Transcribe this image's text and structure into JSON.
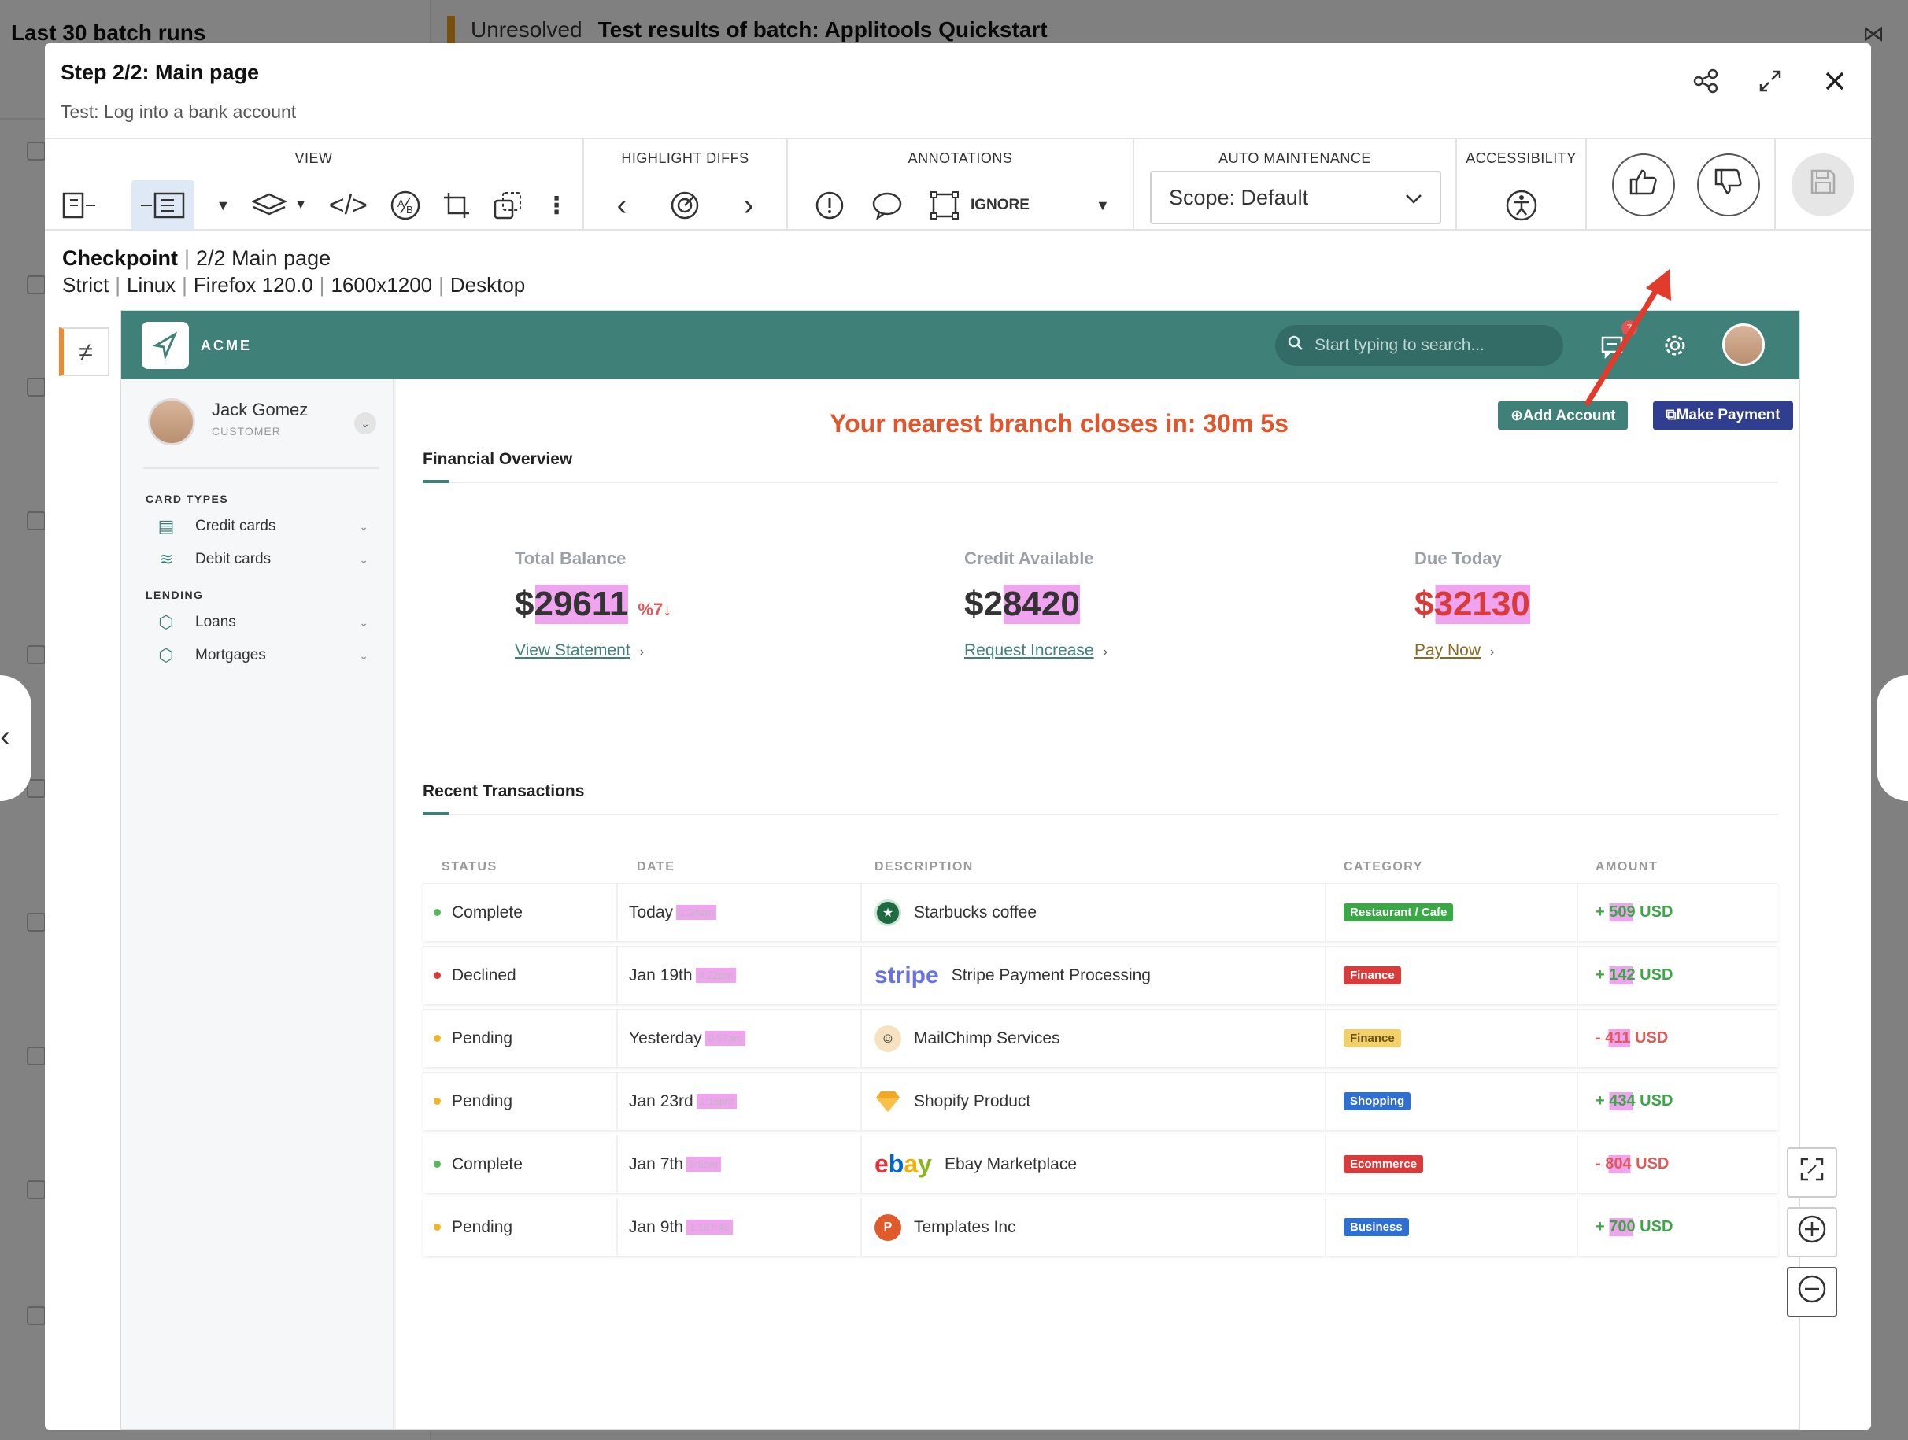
{
  "background": {
    "left_title": "Last 30 batch runs",
    "status": "Unresolved",
    "batch_title": "Test results of batch:  Applitools Quickstart"
  },
  "modal": {
    "step_title": "Step 2/2:  Main page",
    "test_name": "Test: Log into a bank account"
  },
  "toolbar": {
    "view_label": "VIEW",
    "highlight_label": "HIGHLIGHT DIFFS",
    "annotations_label": "ANNOTATIONS",
    "ignore_label": "IGNORE",
    "auto_label": "AUTO MAINTENANCE",
    "scope_value": "Scope: Default",
    "accessibility_label": "ACCESSIBILITY"
  },
  "checkpoint": {
    "label": "Checkpoint",
    "name": "2/2 Main page",
    "details": [
      "Strict",
      "Linux",
      "Firefox 120.0",
      "1600x1200",
      "Desktop"
    ]
  },
  "app": {
    "logo_text": "ACME",
    "search_placeholder": "Start typing to search...",
    "notification_count": "7",
    "user_name": "Jack Gomez",
    "user_role": "CUSTOMER",
    "sections": [
      {
        "title": "CARD TYPES",
        "items": [
          {
            "label": "Credit cards"
          },
          {
            "label": "Debit cards"
          }
        ]
      },
      {
        "title": "LENDING",
        "items": [
          {
            "label": "Loans"
          },
          {
            "label": "Mortgages"
          }
        ]
      }
    ],
    "branch_message": "Your nearest branch closes in: 30m 5s",
    "add_account": "⊕Add Account",
    "make_payment": "⧉Make Payment",
    "overview_title": "Financial Overview",
    "stats": [
      {
        "label": "Total Balance",
        "value": "$29611",
        "delta": "%7↓",
        "link": "View Statement"
      },
      {
        "label": "Credit Available",
        "value": "$28420",
        "delta": "",
        "link": "Request Increase"
      },
      {
        "label": "Due Today",
        "value": "$32130",
        "delta": "",
        "link": "Pay Now"
      }
    ],
    "transactions_title": "Recent Transactions",
    "columns": [
      "STATUS",
      "DATE",
      "DESCRIPTION",
      "CATEGORY",
      "AMOUNT"
    ],
    "transactions": [
      {
        "status": "Complete",
        "status_color": "#5bb75b",
        "date": "Today",
        "time": "1:24am",
        "brand": "starbucks",
        "brand_color": "#1e6b41",
        "description": "Starbucks coffee",
        "category": "Restaurant / Cafe",
        "cat_color": "#3aa845",
        "amount": "+ 509 USD",
        "amt_color": "#3aa845"
      },
      {
        "status": "Declined",
        "status_color": "#d93a3a",
        "date": "Jan 19th",
        "time": "4:22pm",
        "brand": "stripe",
        "brand_color": "#6772e5",
        "description": "Stripe Payment Processing",
        "category": "Finance",
        "cat_color": "#d93a3a",
        "amount": "+ 142 USD",
        "amt_color": "#3aa845"
      },
      {
        "status": "Pending",
        "status_color": "#f0b429",
        "date": "Yesterday",
        "time": "0:57am",
        "brand": "mailchimp",
        "brand_color": "#333333",
        "description": "MailChimp Services",
        "category": "Finance",
        "cat_color": "#f2d06b",
        "amount": "- 411 USD",
        "amt_color": "#e05a5a"
      },
      {
        "status": "Pending",
        "status_color": "#f0b429",
        "date": "Jan 23rd",
        "time": "1:16pm",
        "brand": "shopify",
        "brand_color": "#f5a623",
        "description": "Shopify Product",
        "category": "Shopping",
        "cat_color": "#2f6fd1",
        "amount": "+ 434 USD",
        "amt_color": "#3aa845"
      },
      {
        "status": "Complete",
        "status_color": "#5bb75b",
        "date": "Jan 7th",
        "time": "5:5am",
        "brand": "ebay",
        "brand_color": "#e53238",
        "description": "Ebay Marketplace",
        "category": "Ecommerce",
        "cat_color": "#d93a3a",
        "amount": "- 804 USD",
        "amt_color": "#e05a5a"
      },
      {
        "status": "Pending",
        "status_color": "#f0b429",
        "date": "Jan 9th",
        "time": "1:167:45",
        "brand": "templates",
        "brand_color": "#e05a2b",
        "description": "Templates Inc",
        "category": "Business",
        "cat_color": "#2f6fd1",
        "amount": "+ 700 USD",
        "amt_color": "#3aa845"
      }
    ]
  },
  "colors": {
    "teal": "#3f8078",
    "navy": "#2f3e8f",
    "orange_msg": "#e0552b",
    "diff_highlight": "#e45ae4"
  }
}
